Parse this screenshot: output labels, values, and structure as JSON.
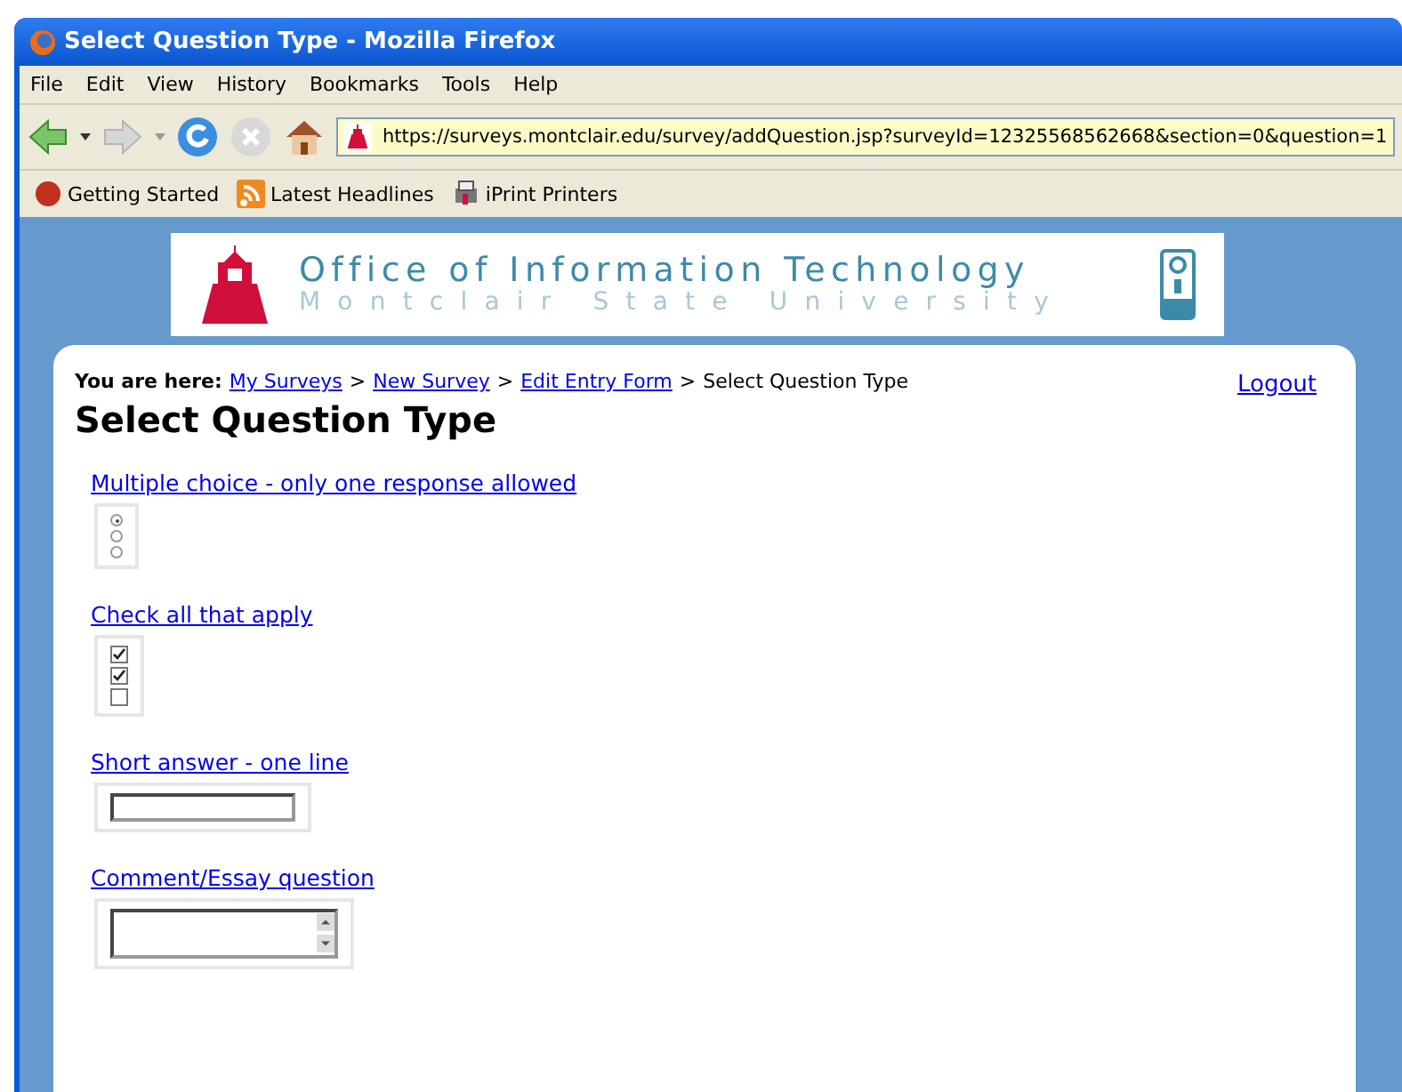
{
  "window": {
    "title": "Select Question Type - Mozilla Firefox"
  },
  "menu": [
    "File",
    "Edit",
    "View",
    "History",
    "Bookmarks",
    "Tools",
    "Help"
  ],
  "address_bar": {
    "value": "https://surveys.montclair.edu/survey/addQuestion.jsp?surveyId=12325568562668&section=0&question=1"
  },
  "bookmarks": [
    "Getting Started",
    "Latest Headlines",
    "iPrint Printers"
  ],
  "banner": {
    "title": "Office of Information Technology",
    "subtitle": "Montclair State University"
  },
  "breadcrumb": {
    "label": "You are here:",
    "links": [
      "My Surveys",
      "New Survey",
      "Edit Entry Form"
    ],
    "separator": ">",
    "current": "Select Question Type"
  },
  "logout": "Logout",
  "heading": "Select Question Type",
  "question_types": [
    {
      "kind": "radio",
      "label": "Multiple choice - only one response allowed",
      "options": [
        {
          "selected": true
        },
        {
          "selected": false
        },
        {
          "selected": false
        }
      ]
    },
    {
      "kind": "checkbox",
      "label": "Check all that apply",
      "options": [
        {
          "checked": true
        },
        {
          "checked": true
        },
        {
          "checked": false
        }
      ]
    },
    {
      "kind": "text",
      "label": "Short answer - one line"
    },
    {
      "kind": "textarea",
      "label": "Comment/Essay question"
    }
  ]
}
